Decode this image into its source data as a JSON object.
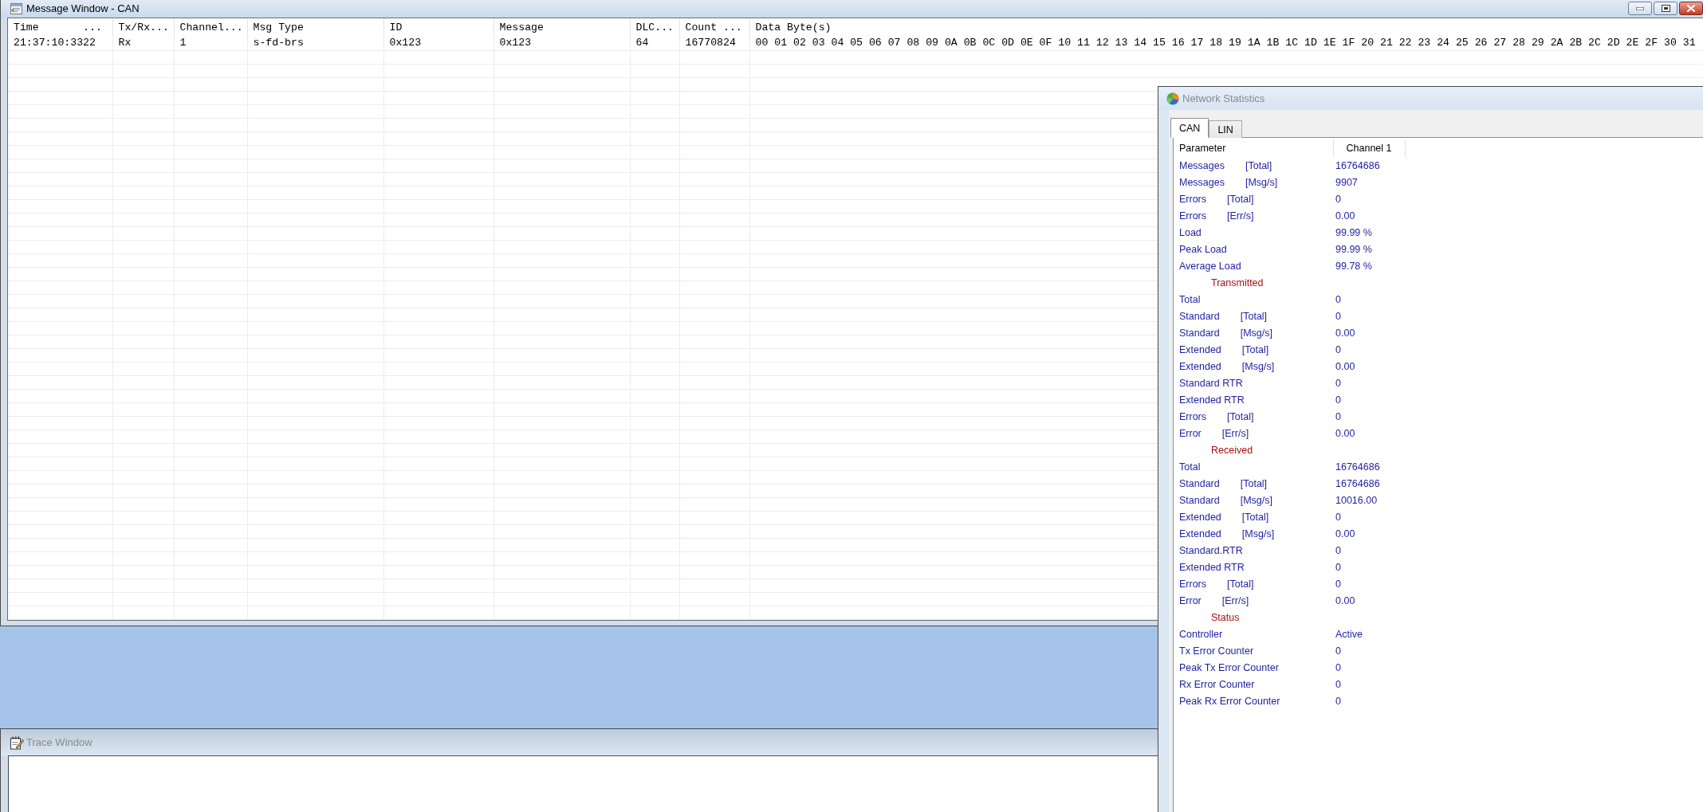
{
  "message_window": {
    "title": "Message Window - CAN",
    "active": true,
    "columns": [
      "Time       ...",
      "Tx/Rx...",
      "Channel...",
      "Msg Type",
      "ID",
      "Message",
      "DLC...",
      "Count ...",
      "Data Byte(s)"
    ],
    "rows": [
      [
        "21:37:10:3322",
        "Rx",
        "1",
        "s-fd-brs",
        "0x123",
        "0x123",
        "64",
        "16770824",
        "00 01 02 03 04 05 06 07 08 09 0A 0B 0C 0D 0E 0F 10 11 12 13 14 15 16 17 18 19 1A 1B 1C 1D 1E 1F 20 21 22 23 24 25 26 27 28 29 2A 2B 2C 2D 2E 2F 30 31"
      ]
    ]
  },
  "network_statistics": {
    "title": "Network Statistics",
    "active": false,
    "tabs": [
      {
        "label": "CAN",
        "selected": true
      },
      {
        "label": "LIN",
        "selected": false
      }
    ],
    "columns": [
      "Parameter",
      "Channel 1"
    ],
    "rows": [
      {
        "kind": "stat",
        "label": "Messages",
        "unit": "[Total]",
        "value": "16764686"
      },
      {
        "kind": "stat",
        "label": "Messages",
        "unit": "[Msg/s]",
        "value": "9907"
      },
      {
        "kind": "stat",
        "label": "Errors",
        "unit": "[Total]",
        "value": "0"
      },
      {
        "kind": "stat",
        "label": "Errors",
        "unit": "[Err/s]",
        "value": "0.00"
      },
      {
        "kind": "stat",
        "label": "Load",
        "value": "99.99 %"
      },
      {
        "kind": "stat",
        "label": "Peak Load",
        "value": "99.99 %"
      },
      {
        "kind": "stat",
        "label": "Average Load",
        "value": "99.78 %"
      },
      {
        "kind": "section",
        "label": "Transmitted"
      },
      {
        "kind": "stat",
        "label": "Total",
        "value": "0"
      },
      {
        "kind": "stat",
        "label": "Standard",
        "unit": "[Total]",
        "value": "0"
      },
      {
        "kind": "stat",
        "label": "Standard",
        "unit": "[Msg/s]",
        "value": "0.00"
      },
      {
        "kind": "stat",
        "label": "Extended",
        "unit": "[Total]",
        "value": "0"
      },
      {
        "kind": "stat",
        "label": "Extended",
        "unit": "[Msg/s]",
        "value": "0.00"
      },
      {
        "kind": "stat",
        "label": "Standard RTR",
        "value": "0"
      },
      {
        "kind": "stat",
        "label": "Extended RTR",
        "value": "0"
      },
      {
        "kind": "stat",
        "label": "Errors",
        "unit": "[Total]",
        "value": "0"
      },
      {
        "kind": "stat",
        "label": "Error",
        "unit": "[Err/s]",
        "value": "0.00"
      },
      {
        "kind": "section",
        "label": "Received"
      },
      {
        "kind": "stat",
        "label": "Total",
        "value": "16764686"
      },
      {
        "kind": "stat",
        "label": "Standard",
        "unit": "[Total]",
        "value": "16764686"
      },
      {
        "kind": "stat",
        "label": "Standard",
        "unit": "[Msg/s]",
        "value": "10016.00"
      },
      {
        "kind": "stat",
        "label": "Extended",
        "unit": "[Total]",
        "value": "0"
      },
      {
        "kind": "stat",
        "label": "Extended",
        "unit": "[Msg/s]",
        "value": "0.00"
      },
      {
        "kind": "stat",
        "label": "Standard.RTR",
        "value": "0"
      },
      {
        "kind": "stat",
        "label": "Extended RTR",
        "value": "0"
      },
      {
        "kind": "stat",
        "label": "Errors",
        "unit": "[Total]",
        "value": "0"
      },
      {
        "kind": "stat",
        "label": "Error",
        "unit": "[Err/s]",
        "value": "0.00"
      },
      {
        "kind": "section",
        "label": "Status"
      },
      {
        "kind": "stat",
        "label": "Controller",
        "value": "Active"
      },
      {
        "kind": "stat",
        "label": "Tx Error Counter",
        "value": "0"
      },
      {
        "kind": "stat",
        "label": "Peak Tx Error Counter",
        "value": "0"
      },
      {
        "kind": "stat",
        "label": "Rx Error Counter",
        "value": "0"
      },
      {
        "kind": "stat",
        "label": "Peak Rx Error Counter",
        "value": "0"
      }
    ]
  },
  "trace_window": {
    "title": "Trace Window",
    "active": false
  }
}
